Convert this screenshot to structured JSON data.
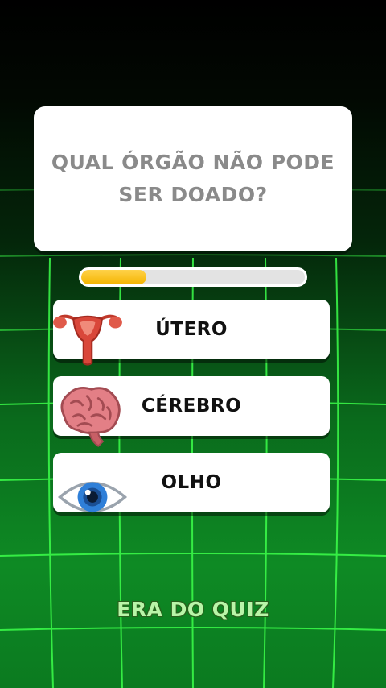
{
  "question": {
    "text": "QUAL ÓRGÃO NÃO PODE SER DOADO?"
  },
  "timer": {
    "progress_fraction": 0.29,
    "fill_color": "#f4b400"
  },
  "options": [
    {
      "label": "ÚTERO",
      "icon": "uterus-icon"
    },
    {
      "label": "CÉREBRO",
      "icon": "brain-icon"
    },
    {
      "label": "OLHO",
      "icon": "eye-icon"
    }
  ],
  "brand": {
    "text": "ERA DO QUIZ"
  },
  "colors": {
    "grid_line": "#3cff4a",
    "background_bottom": "#0e8a24",
    "question_text": "#8a8a8a",
    "brand_text": "#b9f5a8"
  }
}
